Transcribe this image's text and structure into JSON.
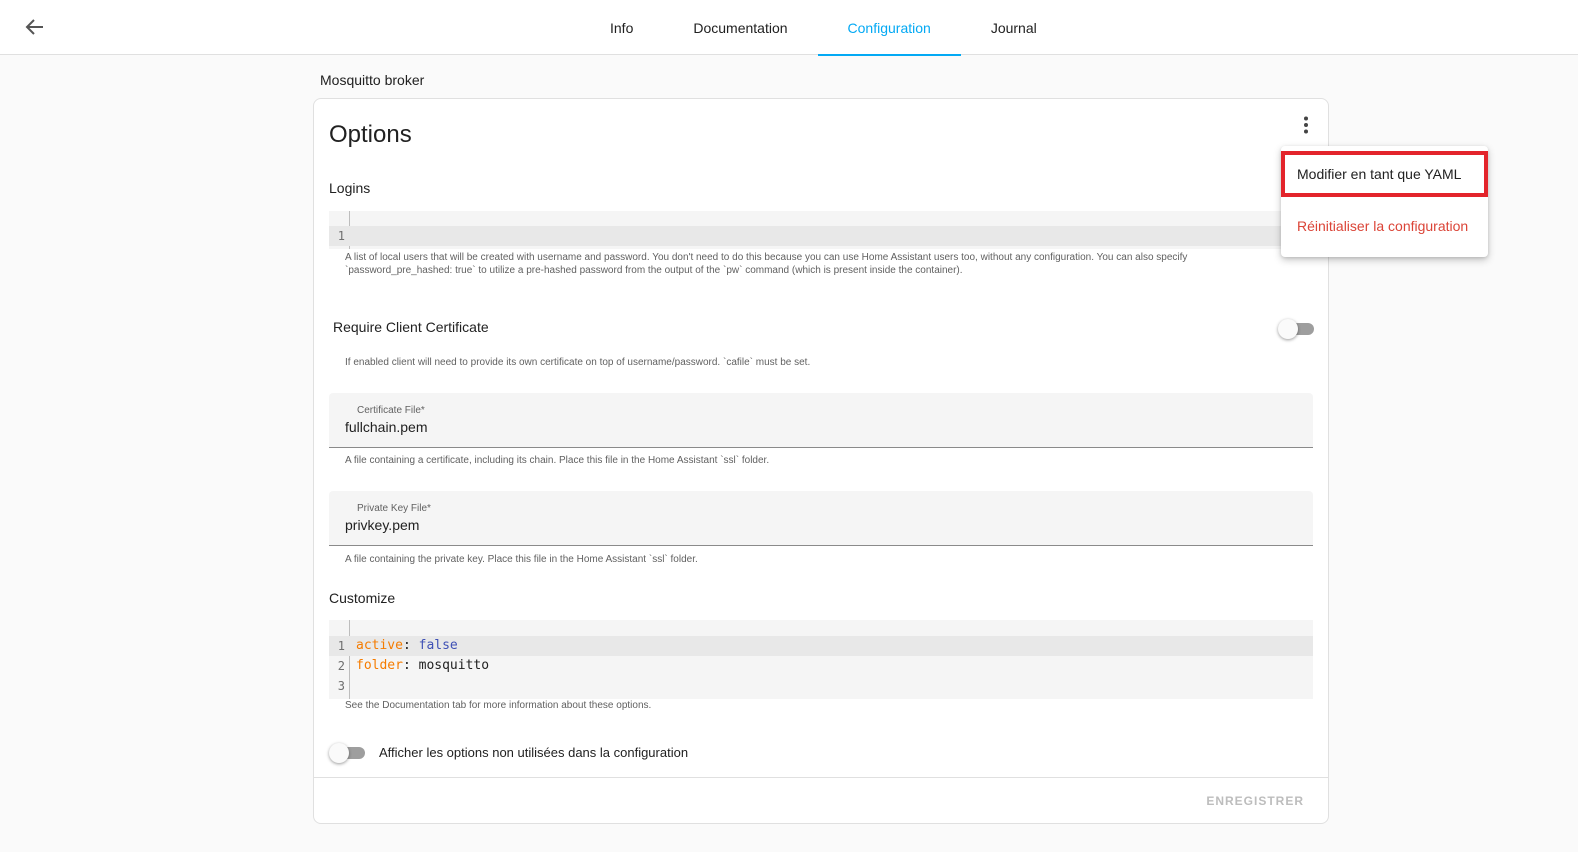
{
  "header": {
    "back_icon": "arrow-left-icon",
    "tabs": [
      {
        "label": "Info",
        "active": false
      },
      {
        "label": "Documentation",
        "active": false
      },
      {
        "label": "Configuration",
        "active": true
      },
      {
        "label": "Journal",
        "active": false
      }
    ]
  },
  "addon": {
    "name": "Mosquitto broker"
  },
  "card": {
    "title": "Options",
    "menu_icon": "dots-vertical-icon",
    "logins": {
      "label": "Logins",
      "lines": [
        {
          "no": "1"
        }
      ],
      "helper_1": "A list of local users that will be created with username and password. You don't need to do this because you can use Home Assistant users too, without any configuration. You can also specify",
      "helper_2": "`password_pre_hashed: true` to utilize a pre-hashed password from the output of the `pw` command (which is present inside the container)."
    },
    "require_cert": {
      "label": "Require Client Certificate",
      "enabled": false,
      "helper": "If enabled client will need to provide its own certificate on top of username/password. `cafile` must be set."
    },
    "certfile": {
      "label": "Certificate File*",
      "value": "fullchain.pem",
      "helper": "A file containing a certificate, including its chain. Place this file in the Home Assistant `ssl` folder."
    },
    "keyfile": {
      "label": "Private Key File*",
      "value": "privkey.pem",
      "helper": "A file containing the private key. Place this file in the Home Assistant `ssl` folder."
    },
    "customize": {
      "label": "Customize",
      "lines": [
        {
          "no": "1",
          "key": "active",
          "sep": ": ",
          "value": "false"
        },
        {
          "no": "2",
          "key": "folder",
          "sep": ": ",
          "value": "mosquitto"
        },
        {
          "no": "3",
          "key": "",
          "sep": "",
          "value": ""
        }
      ],
      "helper": "See the Documentation tab for more information about these options."
    },
    "show_unused": {
      "label": "Afficher les options non utilisées dans la configuration",
      "enabled": false
    },
    "save_label": "ENREGISTRER"
  },
  "menu": {
    "items": [
      {
        "label": "Modifier en tant que YAML",
        "highlighted": true
      },
      {
        "label": "Réinitialiser la configuration",
        "danger": true
      }
    ],
    "colors": {
      "highlight_border": "#e3242b",
      "danger": "#db4437",
      "accent": "#03a9f4"
    }
  }
}
